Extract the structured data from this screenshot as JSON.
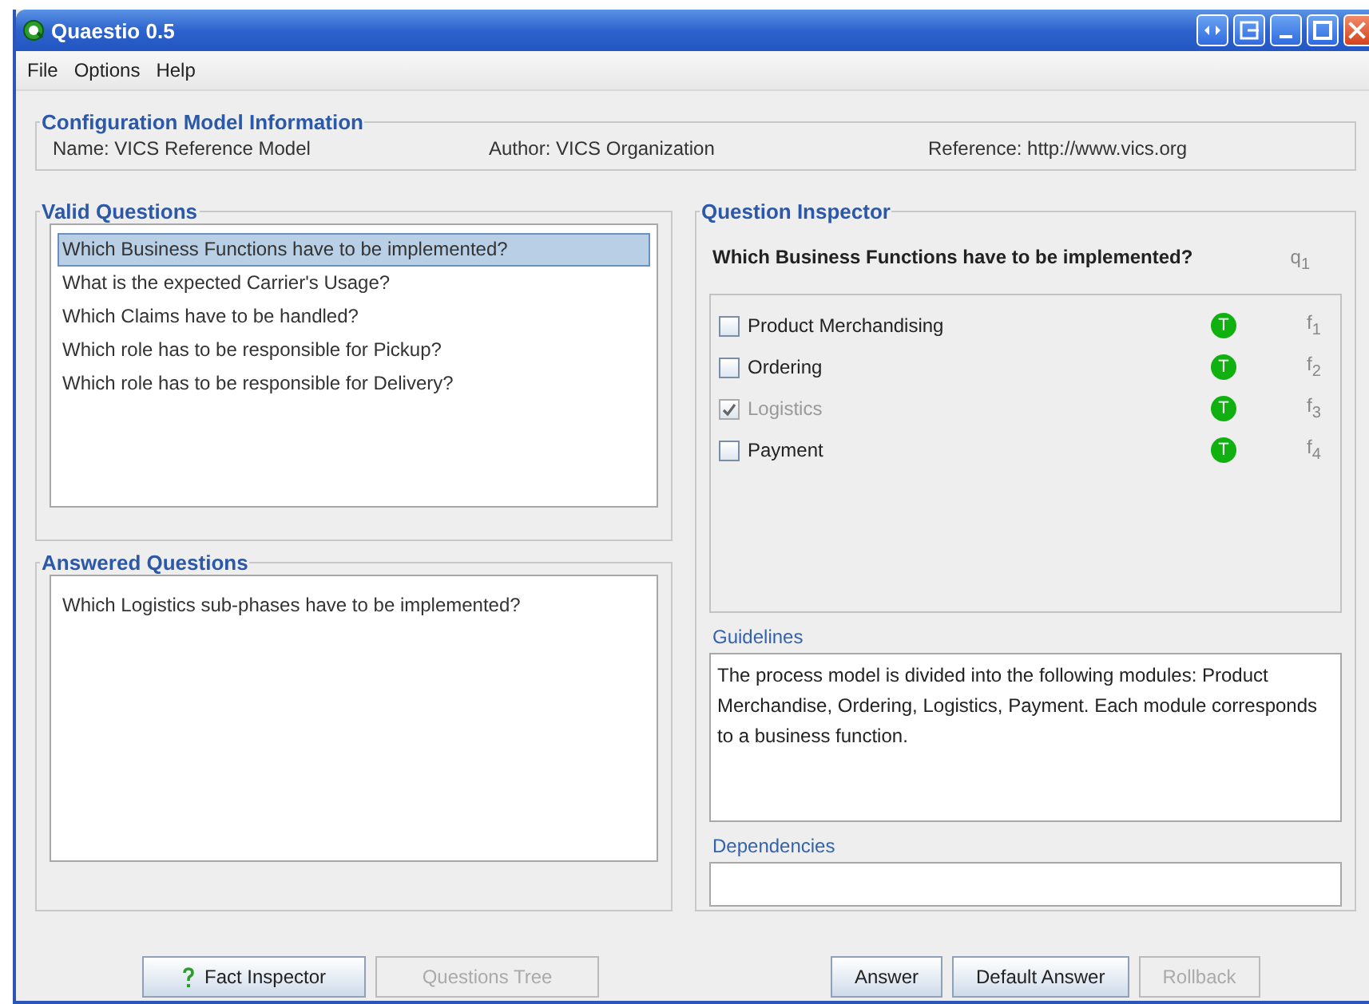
{
  "window": {
    "title": "Quaestio 0.5"
  },
  "menu": [
    "File",
    "Options",
    "Help"
  ],
  "configuration": {
    "title": "Configuration Model Information",
    "fields": [
      "Name: VICS Reference Model",
      "Author: VICS Organization",
      "Reference: http://www.vics.org"
    ]
  },
  "valid_questions": {
    "title": "Valid Questions",
    "items": [
      {
        "text": "Which Business Functions have to be implemented?",
        "selected": true
      },
      {
        "text": "What is the expected Carrier's Usage?",
        "selected": false
      },
      {
        "text": "Which Claims have to be handled?",
        "selected": false
      },
      {
        "text": "Which role has to be responsible for Pickup?",
        "selected": false
      },
      {
        "text": "Which role has to be responsible for Delivery?",
        "selected": false
      }
    ]
  },
  "answered_questions": {
    "title": "Answered Questions",
    "items": [
      {
        "text": "Which Logistics sub-phases have to be implemented?",
        "selected": false
      }
    ]
  },
  "question_inspector": {
    "title": "Question Inspector",
    "question": "Which Business Functions have to be implemented?",
    "question_id": "q$_{1}$",
    "facts": [
      {
        "label": "Product Merchandising",
        "checked": false,
        "disabled": false,
        "badge": "T",
        "id": "f$_{1}$"
      },
      {
        "label": "Ordering",
        "checked": false,
        "disabled": false,
        "badge": "T",
        "id": "f$_{2}$"
      },
      {
        "label": "Logistics",
        "checked": true,
        "disabled": true,
        "badge": "T",
        "id": "f$_{3}$"
      },
      {
        "label": "Payment",
        "checked": false,
        "disabled": false,
        "badge": "T",
        "id": "f$_{4}$"
      }
    ],
    "guidelines_label": "Guidelines",
    "guidelines": "The process model is divided into the following modules: Product Merchandise, Ordering, Logistics, Payment. Each module corresponds to a business function.",
    "dependencies_label": "Dependencies"
  },
  "left_buttons": [
    {
      "label": "Fact Inspector",
      "disabled": false,
      "icon": true
    },
    {
      "label": "Questions Tree",
      "disabled": true,
      "icon": false
    }
  ],
  "right_buttons": [
    {
      "label": "Answer",
      "disabled": false
    },
    {
      "label": "Default Answer",
      "disabled": false
    },
    {
      "label": "Rollback",
      "disabled": true
    }
  ]
}
